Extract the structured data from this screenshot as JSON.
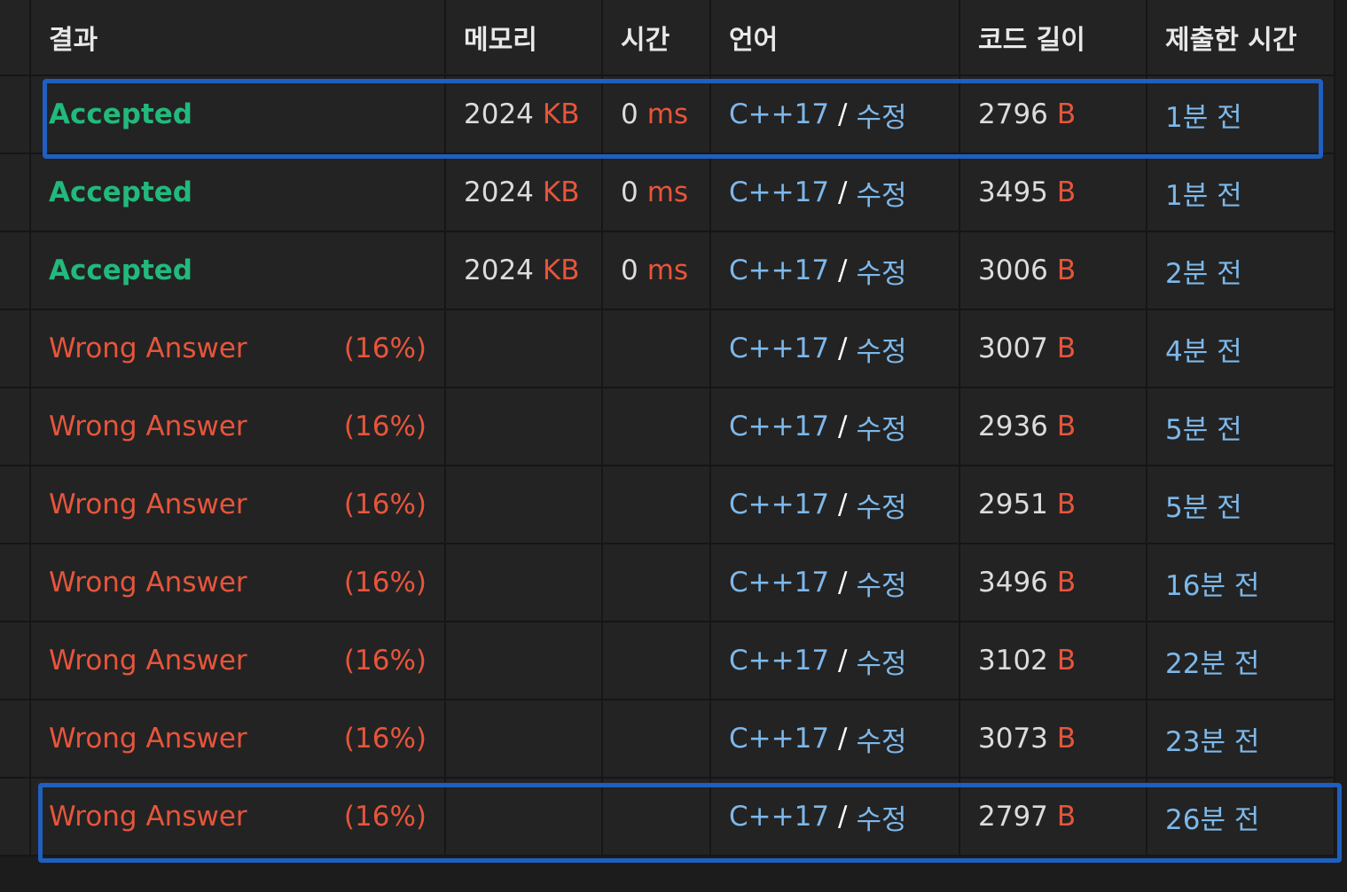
{
  "headers": [
    "결과",
    "메모리",
    "시간",
    "언어",
    "코드 길이",
    "제출한 시간"
  ],
  "rows": [
    {
      "result": "Accepted",
      "status": "accepted",
      "pct": "",
      "memory": "2024",
      "memory_unit": "KB",
      "time": "0",
      "time_unit": "ms",
      "lang": "C++17",
      "edit": "수정",
      "code_len": "2796",
      "code_unit": "B",
      "submitted": "1분 전"
    },
    {
      "result": "Accepted",
      "status": "accepted",
      "pct": "",
      "memory": "2024",
      "memory_unit": "KB",
      "time": "0",
      "time_unit": "ms",
      "lang": "C++17",
      "edit": "수정",
      "code_len": "3495",
      "code_unit": "B",
      "submitted": "1분 전"
    },
    {
      "result": "Accepted",
      "status": "accepted",
      "pct": "",
      "memory": "2024",
      "memory_unit": "KB",
      "time": "0",
      "time_unit": "ms",
      "lang": "C++17",
      "edit": "수정",
      "code_len": "3006",
      "code_unit": "B",
      "submitted": "2분 전"
    },
    {
      "result": "Wrong Answer",
      "status": "wrong",
      "pct": "(16%)",
      "memory": "",
      "memory_unit": "",
      "time": "",
      "time_unit": "",
      "lang": "C++17",
      "edit": "수정",
      "code_len": "3007",
      "code_unit": "B",
      "submitted": "4분 전"
    },
    {
      "result": "Wrong Answer",
      "status": "wrong",
      "pct": "(16%)",
      "memory": "",
      "memory_unit": "",
      "time": "",
      "time_unit": "",
      "lang": "C++17",
      "edit": "수정",
      "code_len": "2936",
      "code_unit": "B",
      "submitted": "5분 전"
    },
    {
      "result": "Wrong Answer",
      "status": "wrong",
      "pct": "(16%)",
      "memory": "",
      "memory_unit": "",
      "time": "",
      "time_unit": "",
      "lang": "C++17",
      "edit": "수정",
      "code_len": "2951",
      "code_unit": "B",
      "submitted": "5분 전"
    },
    {
      "result": "Wrong Answer",
      "status": "wrong",
      "pct": "(16%)",
      "memory": "",
      "memory_unit": "",
      "time": "",
      "time_unit": "",
      "lang": "C++17",
      "edit": "수정",
      "code_len": "3496",
      "code_unit": "B",
      "submitted": "16분 전"
    },
    {
      "result": "Wrong Answer",
      "status": "wrong",
      "pct": "(16%)",
      "memory": "",
      "memory_unit": "",
      "time": "",
      "time_unit": "",
      "lang": "C++17",
      "edit": "수정",
      "code_len": "3102",
      "code_unit": "B",
      "submitted": "22분 전"
    },
    {
      "result": "Wrong Answer",
      "status": "wrong",
      "pct": "(16%)",
      "memory": "",
      "memory_unit": "",
      "time": "",
      "time_unit": "",
      "lang": "C++17",
      "edit": "수정",
      "code_len": "3073",
      "code_unit": "B",
      "submitted": "23분 전"
    },
    {
      "result": "Wrong Answer",
      "status": "wrong",
      "pct": "(16%)",
      "memory": "",
      "memory_unit": "",
      "time": "",
      "time_unit": "",
      "lang": "C++17",
      "edit": "수정",
      "code_len": "2797",
      "code_unit": "B",
      "submitted": "26분 전"
    }
  ],
  "highlighted_rows": [
    0,
    9
  ],
  "colors": {
    "accepted": "#22b97c",
    "wrong": "#e7553b",
    "link": "#7db8ea",
    "highlight": "#1f5fc0",
    "background": "#232323"
  }
}
